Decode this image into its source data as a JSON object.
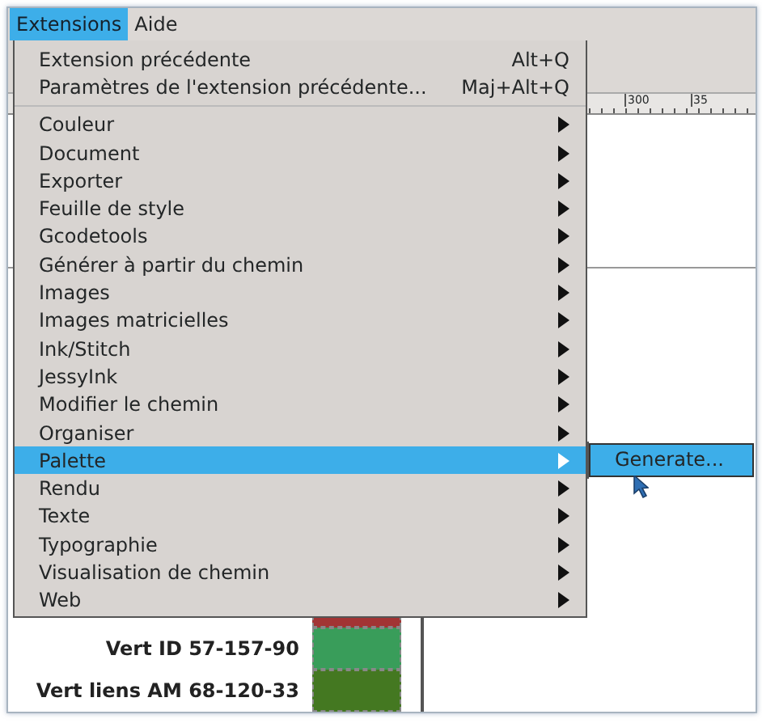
{
  "menubar": [
    {
      "label": "Extensions",
      "selected": true
    },
    {
      "label": "Aide",
      "selected": false
    }
  ],
  "menu": {
    "items": [
      {
        "kind": "command",
        "label": "Extension précédente",
        "shortcut": "Alt+Q",
        "selected": false
      },
      {
        "kind": "command",
        "label": "Paramètres de l'extension précédente...",
        "shortcut": "Maj+Alt+Q",
        "selected": false
      },
      {
        "kind": "separator"
      },
      {
        "kind": "submenu",
        "label": "Couleur",
        "selected": false
      },
      {
        "kind": "submenu",
        "label": "Document",
        "selected": false
      },
      {
        "kind": "submenu",
        "label": "Exporter",
        "selected": false
      },
      {
        "kind": "submenu",
        "label": "Feuille de style",
        "selected": false
      },
      {
        "kind": "submenu",
        "label": "Gcodetools",
        "selected": false
      },
      {
        "kind": "submenu",
        "label": "Générer à partir du chemin",
        "selected": false
      },
      {
        "kind": "submenu",
        "label": "Images",
        "selected": false
      },
      {
        "kind": "submenu",
        "label": "Images matricielles",
        "selected": false
      },
      {
        "kind": "submenu",
        "label": "Ink/Stitch",
        "selected": false
      },
      {
        "kind": "submenu",
        "label": "JessyInk",
        "selected": false
      },
      {
        "kind": "submenu",
        "label": "Modifier le chemin",
        "selected": false
      },
      {
        "kind": "submenu",
        "label": "Organiser",
        "selected": false
      },
      {
        "kind": "submenu",
        "label": "Palette",
        "selected": true
      },
      {
        "kind": "submenu",
        "label": "Rendu",
        "selected": false
      },
      {
        "kind": "submenu",
        "label": "Texte",
        "selected": false
      },
      {
        "kind": "submenu",
        "label": "Typographie",
        "selected": false
      },
      {
        "kind": "submenu",
        "label": "Visualisation de chemin",
        "selected": false
      },
      {
        "kind": "submenu",
        "label": "Web",
        "selected": false
      }
    ]
  },
  "submenu": {
    "items": [
      {
        "label": "Generate...",
        "selected": true
      }
    ]
  },
  "ruler": {
    "labels": [
      "300",
      "35"
    ]
  },
  "canvas": {
    "swatches": [
      {
        "color": "#a23434"
      },
      {
        "label": "Vert ID 57-157-90",
        "color": "#399d5a"
      },
      {
        "label": "Vert liens AM 68-120-33",
        "color": "#447821"
      }
    ]
  }
}
